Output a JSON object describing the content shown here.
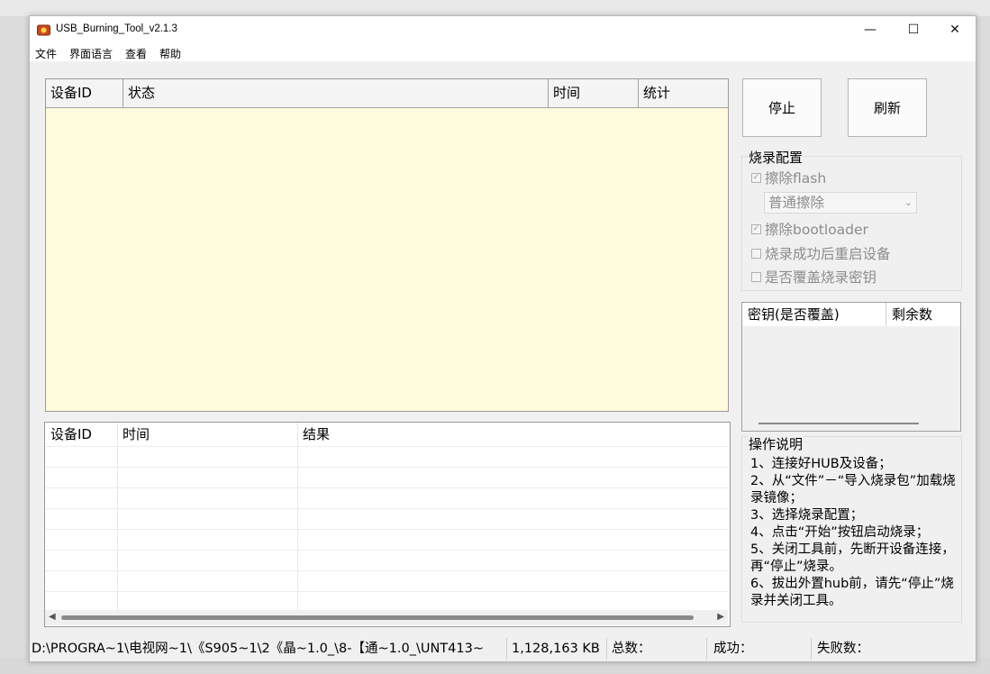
{
  "window": {
    "title": "USB_Burning_Tool_v2.1.3",
    "controls": {
      "minimize": "—",
      "maximize": "☐",
      "close": "✕"
    }
  },
  "menu": [
    "文件",
    "界面语言",
    "查看",
    "帮助"
  ],
  "device_table": {
    "columns": [
      "设备ID",
      "状态",
      "时间",
      "统计"
    ],
    "rows": [],
    "background": "#fffbdc"
  },
  "result_table": {
    "columns": [
      "设备ID",
      "时间",
      "结果"
    ],
    "rows": []
  },
  "buttons": {
    "stop": "停止",
    "refresh": "刷新"
  },
  "burn_config": {
    "title": "烧录配置",
    "erase_flash": {
      "label": "擦除flash",
      "checked": true,
      "enabled": false
    },
    "erase_mode": {
      "value": "普通擦除",
      "enabled": false
    },
    "erase_bootloader": {
      "label": "擦除bootloader",
      "checked": true,
      "enabled": false
    },
    "reboot_after": {
      "label": "烧录成功后重启设备",
      "checked": false,
      "enabled": false
    },
    "overwrite_key": {
      "label": "是否覆盖烧录密钥",
      "checked": false,
      "enabled": false
    }
  },
  "key_table": {
    "columns": [
      "密钥(是否覆盖)",
      "剩余数"
    ]
  },
  "instructions": {
    "title": "操作说明",
    "text": "1、连接好HUB及设备；\n2、从“文件”－“导入烧录包”加载烧录镜像；\n3、选择烧录配置；\n4、点击“开始”按钮启动烧录；\n5、关闭工具前，先断开设备连接，再“停止”烧录。\n6、拔出外置hub前，请先“停止”烧录并关闭工具。"
  },
  "status_bar": {
    "path": "D:\\PROGRA~1\\电视网~1\\《S905~1\\2《晶~1.0_\\8-【通~1.0_\\UNT413~",
    "size": "1,128,163 KB",
    "total": "总数：",
    "success": "成功：",
    "failed": "失败数："
  }
}
